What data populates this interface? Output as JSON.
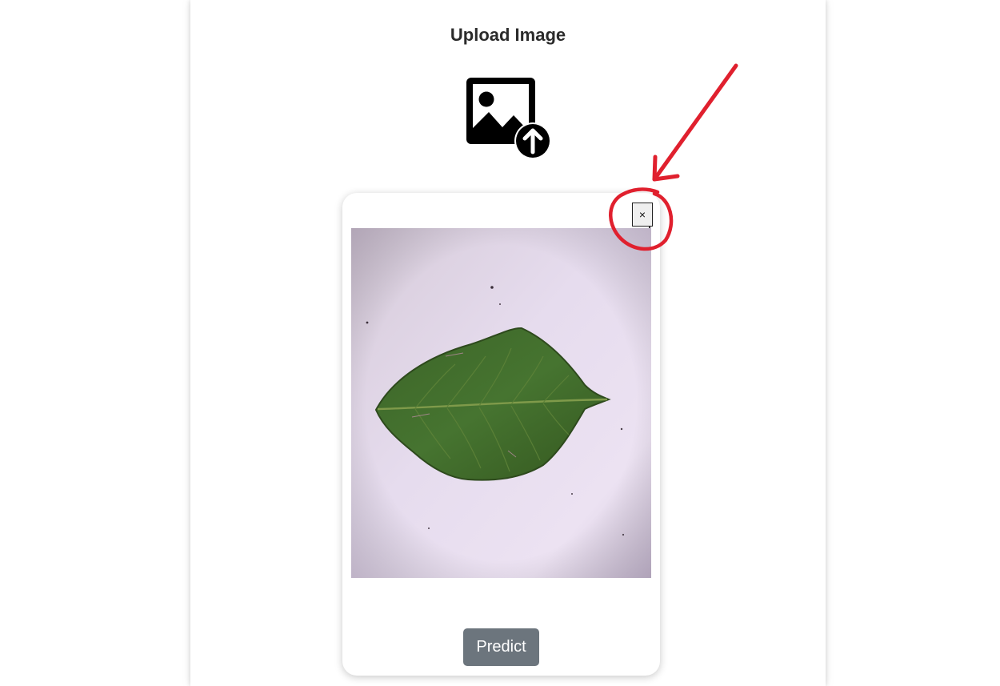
{
  "page": {
    "title": "Upload Image"
  },
  "upload_area": {
    "icon": "image-upload-icon"
  },
  "preview_card": {
    "close_label": "×",
    "image_subject": "leaf-photo",
    "predict_label": "Predict"
  },
  "colors": {
    "panel_bg": "#ffffff",
    "predict_button_bg": "#6c757d",
    "annotation_red": "#e0202e",
    "leaf_green": "#3f6b2c",
    "photo_background": "#e2d6ec"
  }
}
